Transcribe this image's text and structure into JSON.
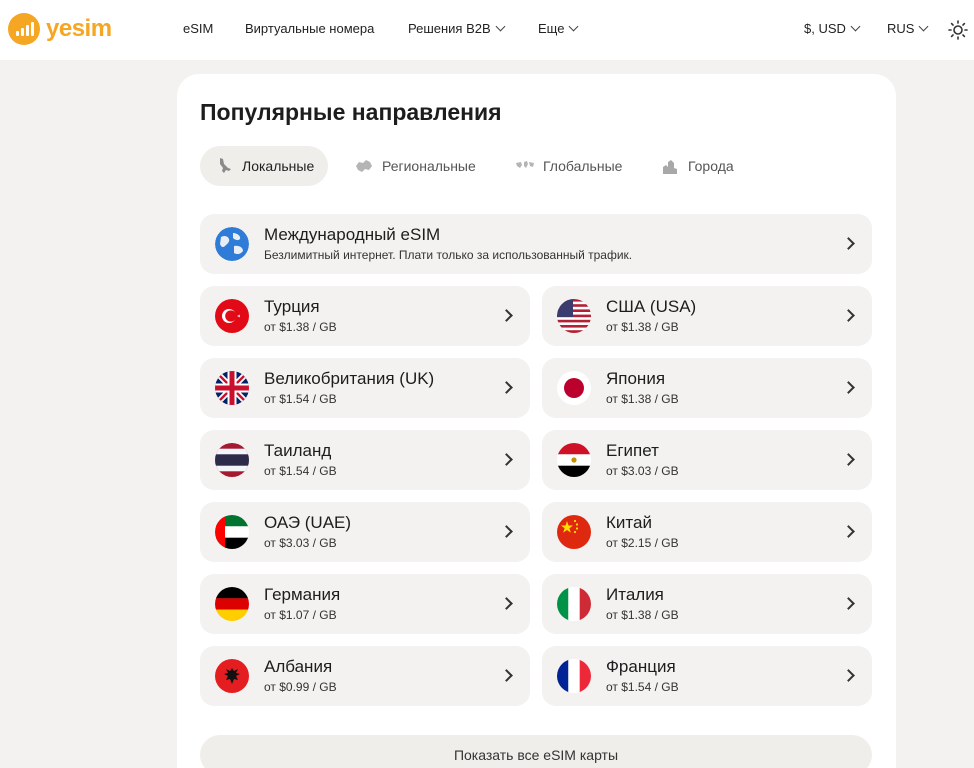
{
  "header": {
    "logo_text": "yesim",
    "nav": {
      "esim": "eSIM",
      "virtual_numbers": "Виртуальные номера",
      "b2b": "Решения B2B",
      "more": "Еще"
    },
    "currency": "$, USD",
    "language": "RUS"
  },
  "main": {
    "title": "Популярные направления",
    "tabs": [
      {
        "label": "Локальные",
        "active": true
      },
      {
        "label": "Региональные",
        "active": false
      },
      {
        "label": "Глобальные",
        "active": false
      },
      {
        "label": "Города",
        "active": false
      }
    ],
    "international": {
      "name": "Международный eSIM",
      "subtitle": "Безлимитный интернет. Плати только за использованный трафик."
    },
    "destinations": [
      {
        "name": "Турция",
        "price": "от $1.38 / GB",
        "flag": "turkey-flag"
      },
      {
        "name": "США (USA)",
        "price": "от $1.38 / GB",
        "flag": "usa-flag"
      },
      {
        "name": "Великобритания (UK)",
        "price": "от $1.54 / GB",
        "flag": "uk-flag"
      },
      {
        "name": "Япония",
        "price": "от $1.38 / GB",
        "flag": "japan-flag"
      },
      {
        "name": "Таиланд",
        "price": "от $1.54 / GB",
        "flag": "thailand-flag"
      },
      {
        "name": "Египет",
        "price": "от $3.03 / GB",
        "flag": "egypt-flag"
      },
      {
        "name": "ОАЭ (UAE)",
        "price": "от $3.03 / GB",
        "flag": "uae-flag"
      },
      {
        "name": "Китай",
        "price": "от $2.15 / GB",
        "flag": "china-flag"
      },
      {
        "name": "Германия",
        "price": "от $1.07 / GB",
        "flag": "germany-flag"
      },
      {
        "name": "Италия",
        "price": "от $1.38 / GB",
        "flag": "italy-flag"
      },
      {
        "name": "Албания",
        "price": "от $0.99 / GB",
        "flag": "albania-flag"
      },
      {
        "name": "Франция",
        "price": "от $1.54 / GB",
        "flag": "france-flag"
      }
    ],
    "show_all": "Показать все eSIM карты"
  },
  "colors": {
    "brand": "#f5a623",
    "background": "#f3f2f0",
    "card": "#ffffff"
  }
}
